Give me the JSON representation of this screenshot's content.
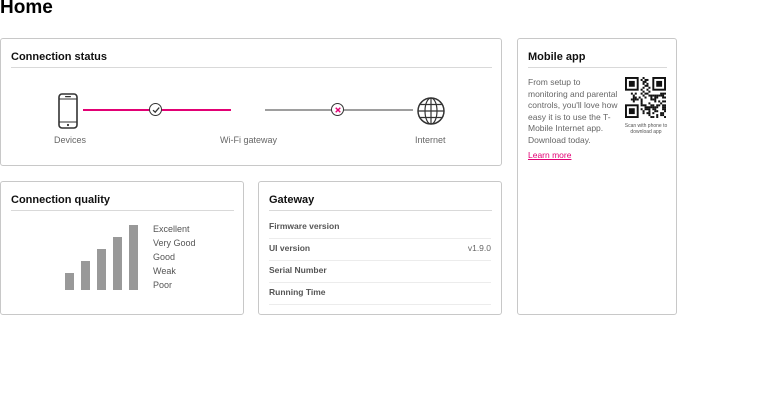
{
  "page": {
    "title": "Home"
  },
  "connection_status": {
    "title": "Connection status",
    "nodes": {
      "devices": "Devices",
      "gateway": "Wi-Fi gateway",
      "internet": "Internet"
    },
    "links": [
      {
        "from": "Devices",
        "to": "Wi-Fi gateway",
        "state": "connected",
        "icon": "check-icon"
      },
      {
        "from": "Wi-Fi gateway",
        "to": "Internet",
        "state": "disconnected",
        "icon": "x-icon"
      }
    ],
    "colors": {
      "connected": "#e20074",
      "disconnected": "#9e9e9e"
    }
  },
  "connection_quality": {
    "title": "Connection quality",
    "levels": [
      "Excellent",
      "Very Good",
      "Good",
      "Weak",
      "Poor"
    ],
    "signal_bars": 5,
    "bar_color": "#9e9e9e"
  },
  "gateway": {
    "title": "Gateway",
    "rows": [
      {
        "label": "Firmware version",
        "value": ""
      },
      {
        "label": "UI version",
        "value": "v1.9.0"
      },
      {
        "label": "Serial Number",
        "value": ""
      },
      {
        "label": "Running Time",
        "value": ""
      }
    ]
  },
  "mobile_app": {
    "title": "Mobile app",
    "description": "From setup to monitoring and parental controls, you'll love how easy it is to use the T-Mobile Internet app. Download today.",
    "qr_caption": "Scan with phone to download app",
    "learn_more": "Learn more",
    "accent_color": "#e20074"
  }
}
